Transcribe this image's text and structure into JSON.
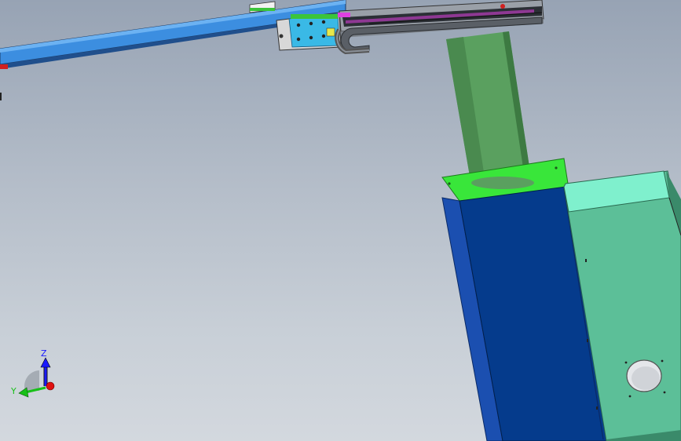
{
  "viewport": {
    "background_top": "#97a3b4",
    "background_bottom": "#d3d8de"
  },
  "model": {
    "beam_color": "#3c8ee0",
    "slide_block_color": "#3ab9e6",
    "cable_chain_color": "#5a5f66",
    "cylinder_color": "#5aa05f",
    "top_cap_color": "#39e63a",
    "cabinet_front_color": "#053b8c",
    "cabinet_side_color": "#1b4fb0",
    "side_box_color": "#5cbf98",
    "side_box_top_color": "#7ff0cd",
    "accent_magenta": "#e040e0",
    "accent_red": "#d02020"
  },
  "triad": {
    "z_label": "Z",
    "y_label": "Y",
    "z_color": "#1a1aff",
    "y_color": "#18c018",
    "x_color": "#e01010"
  }
}
